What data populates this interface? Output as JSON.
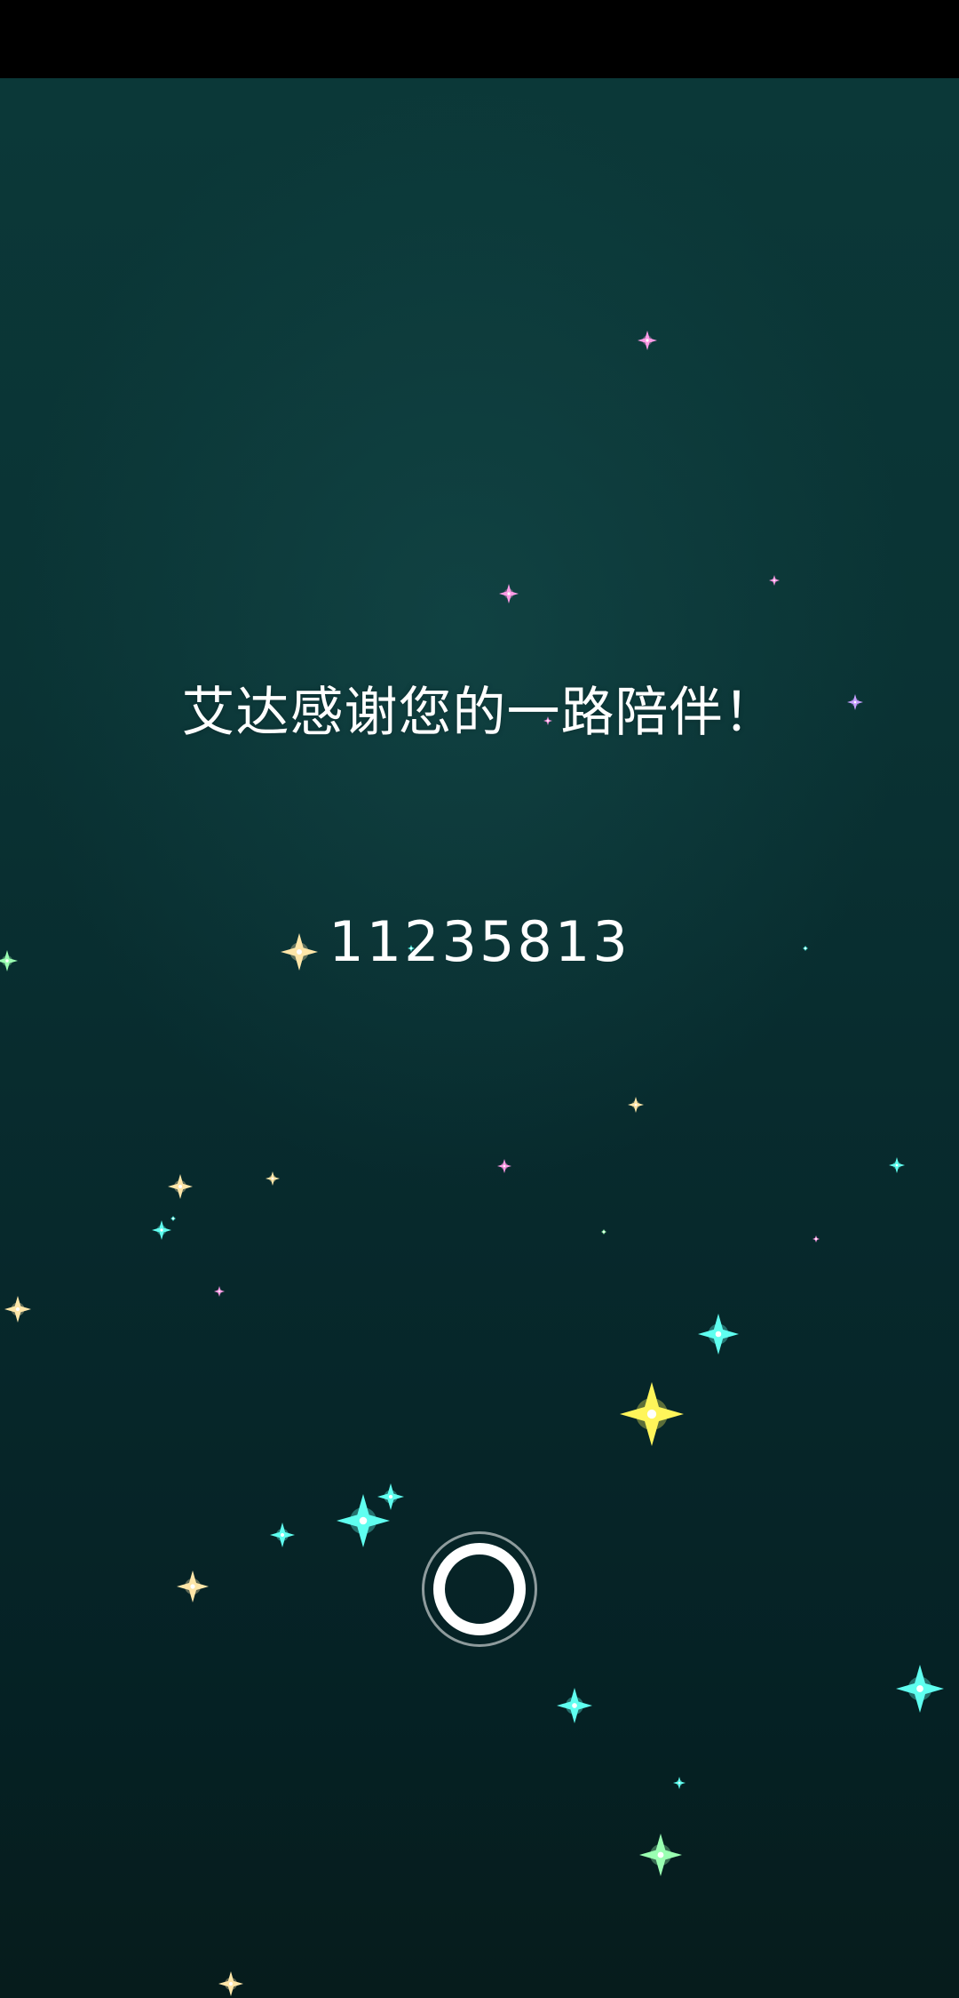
{
  "screen": {
    "message": "艾达感谢您的一路陪伴！",
    "code": "11235813"
  },
  "action_button": {
    "icon": "ring-icon"
  },
  "colors": {
    "background_top": "#0b3838",
    "background_bottom": "#052124",
    "text": "#ffffff",
    "star_palette": [
      "#ffe6a8",
      "#ff9be6",
      "#5ffff0",
      "#fff55a",
      "#c8a0ff",
      "#9affb2"
    ]
  }
}
